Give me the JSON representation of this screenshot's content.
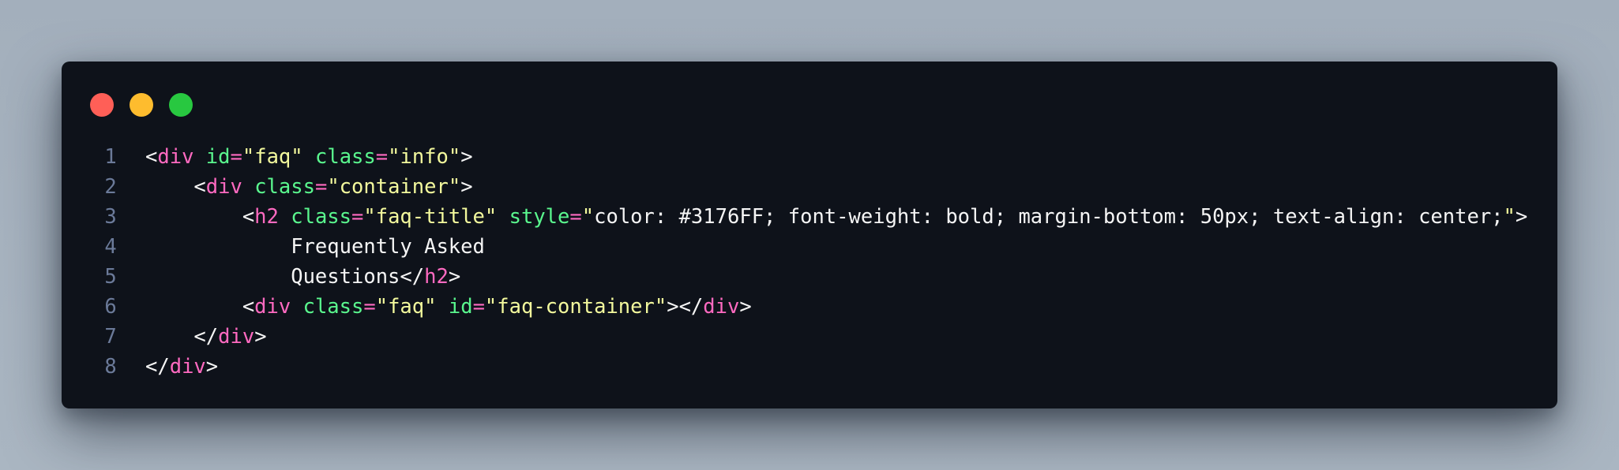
{
  "colors": {
    "background": "#a8b4c0",
    "editor_bg": "#0e121a",
    "line_number": "#6b7a99",
    "punctuation": "#f5f5f5",
    "tag": "#ff6ac1",
    "attribute": "#5af78e",
    "string": "#f3f99d",
    "text": "#f5f5f5",
    "dot_red": "#ff5f57",
    "dot_yellow": "#febc2e",
    "dot_green": "#28c840"
  },
  "window": {
    "controls": [
      {
        "name": "close-dot",
        "color": "#ff5f57"
      },
      {
        "name": "minimize-dot",
        "color": "#febc2e"
      },
      {
        "name": "zoom-dot",
        "color": "#28c840"
      }
    ]
  },
  "code": {
    "lines": [
      {
        "number": "1",
        "tokens": [
          {
            "t": "punct",
            "v": "<"
          },
          {
            "t": "tag",
            "v": "div"
          },
          {
            "t": "punct",
            "v": " "
          },
          {
            "t": "attr",
            "v": "id"
          },
          {
            "t": "tag",
            "v": "="
          },
          {
            "t": "str",
            "v": "\"faq\""
          },
          {
            "t": "punct",
            "v": " "
          },
          {
            "t": "attr",
            "v": "class"
          },
          {
            "t": "tag",
            "v": "="
          },
          {
            "t": "str",
            "v": "\"info\""
          },
          {
            "t": "punct",
            "v": ">"
          }
        ]
      },
      {
        "number": "2",
        "tokens": [
          {
            "t": "punct",
            "v": "    <"
          },
          {
            "t": "tag",
            "v": "div"
          },
          {
            "t": "punct",
            "v": " "
          },
          {
            "t": "attr",
            "v": "class"
          },
          {
            "t": "tag",
            "v": "="
          },
          {
            "t": "str",
            "v": "\"container\""
          },
          {
            "t": "punct",
            "v": ">"
          }
        ]
      },
      {
        "number": "3",
        "tokens": [
          {
            "t": "punct",
            "v": "        <"
          },
          {
            "t": "tag",
            "v": "h2"
          },
          {
            "t": "punct",
            "v": " "
          },
          {
            "t": "attr",
            "v": "class"
          },
          {
            "t": "tag",
            "v": "="
          },
          {
            "t": "str",
            "v": "\"faq-title\""
          },
          {
            "t": "punct",
            "v": " "
          },
          {
            "t": "attr",
            "v": "style"
          },
          {
            "t": "tag",
            "v": "="
          },
          {
            "t": "str",
            "v": "\""
          },
          {
            "t": "text",
            "v": "color: #3176FF; font-weight: bold; margin-bottom: 50px; text-align: center;"
          },
          {
            "t": "str",
            "v": "\""
          },
          {
            "t": "punct",
            "v": ">"
          }
        ]
      },
      {
        "number": "4",
        "tokens": [
          {
            "t": "text",
            "v": "            Frequently Asked"
          }
        ]
      },
      {
        "number": "5",
        "tokens": [
          {
            "t": "text",
            "v": "            Questions"
          },
          {
            "t": "punct",
            "v": "</"
          },
          {
            "t": "tag",
            "v": "h2"
          },
          {
            "t": "punct",
            "v": ">"
          }
        ]
      },
      {
        "number": "6",
        "tokens": [
          {
            "t": "punct",
            "v": "        <"
          },
          {
            "t": "tag",
            "v": "div"
          },
          {
            "t": "punct",
            "v": " "
          },
          {
            "t": "attr",
            "v": "class"
          },
          {
            "t": "tag",
            "v": "="
          },
          {
            "t": "str",
            "v": "\"faq\""
          },
          {
            "t": "punct",
            "v": " "
          },
          {
            "t": "attr",
            "v": "id"
          },
          {
            "t": "tag",
            "v": "="
          },
          {
            "t": "str",
            "v": "\"faq-container\""
          },
          {
            "t": "punct",
            "v": "></"
          },
          {
            "t": "tag",
            "v": "div"
          },
          {
            "t": "punct",
            "v": ">"
          }
        ]
      },
      {
        "number": "7",
        "tokens": [
          {
            "t": "punct",
            "v": "    </"
          },
          {
            "t": "tag",
            "v": "div"
          },
          {
            "t": "punct",
            "v": ">"
          }
        ]
      },
      {
        "number": "8",
        "tokens": [
          {
            "t": "punct",
            "v": "</"
          },
          {
            "t": "tag",
            "v": "div"
          },
          {
            "t": "punct",
            "v": ">"
          }
        ]
      }
    ]
  }
}
